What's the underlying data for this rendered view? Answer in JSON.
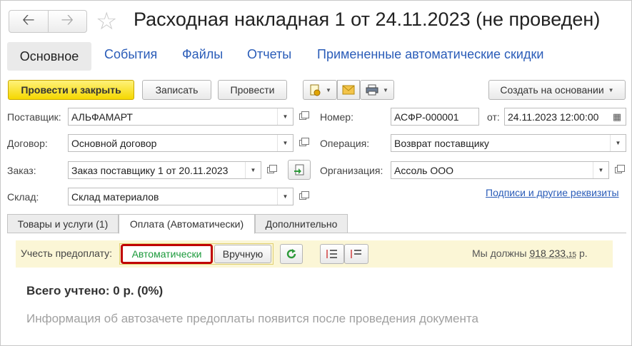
{
  "window": {
    "title": "Расходная накладная 1 от 24.11.2023 (не проведен)"
  },
  "nav_tabs": [
    "Основное",
    "События",
    "Файлы",
    "Отчеты",
    "Примененные автоматические скидки"
  ],
  "toolbar": {
    "post_and_close": "Провести и закрыть",
    "save": "Записать",
    "post": "Провести",
    "create_based_on": "Создать на основании"
  },
  "fields": {
    "supplier": {
      "label": "Поставщик:",
      "value": "АЛЬФАМАРТ"
    },
    "contract": {
      "label": "Договор:",
      "value": "Основной договор"
    },
    "order": {
      "label": "Заказ:",
      "value": "Заказ поставщику 1 от 20.11.2023"
    },
    "warehouse": {
      "label": "Склад:",
      "value": "Склад материалов"
    },
    "number": {
      "label": "Номер:",
      "value": "АСФР-000001"
    },
    "date": {
      "label": "от:",
      "value": "24.11.2023 12:00:00"
    },
    "operation": {
      "label": "Операция:",
      "value": "Возврат поставщику"
    },
    "organization": {
      "label": "Организация:",
      "value": "Ассоль ООО"
    }
  },
  "signatures_link": "Подписи и другие реквизиты",
  "sub_tabs": [
    "Товары и услуги (1)",
    "Оплата (Автоматически)",
    "Дополнительно"
  ],
  "payment": {
    "prepayment_label": "Учесть предоплату:",
    "mode_auto": "Автоматически",
    "mode_manual": "Вручную",
    "we_owe_label": "Мы должны",
    "we_owe_amount": "918 233,",
    "we_owe_kop": "15",
    "we_owe_currency": " р.",
    "total_accounted": "Всего учтено: 0 р. (0%)",
    "info_text": "Информация об автозачете предоплаты появится после проведения документа"
  }
}
